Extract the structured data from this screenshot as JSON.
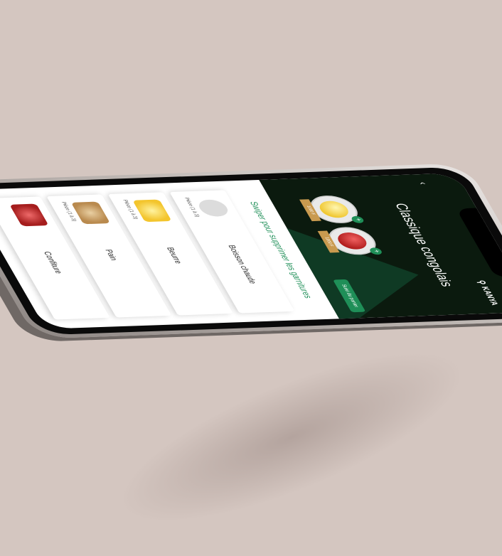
{
  "header": {
    "title": "Classique congolais",
    "brand": "KANYA",
    "back_icon": "back-arrow-icon",
    "pickup_badge": "Suivi du panier"
  },
  "dishes": [
    {
      "name": "Beurre",
      "price": "1000 F"
    },
    {
      "name": "Jambon",
      "price": "1000 F"
    }
  ],
  "hint": "Swiper pour supprimer les garnitures",
  "items": [
    {
      "name": "Boisson chaude",
      "meta": "Pièce (1 à 3)"
    },
    {
      "name": "Beurre",
      "meta": "Pièce (1 à 3)"
    },
    {
      "name": "Pain",
      "meta": "Pièce (1 à 3)"
    },
    {
      "name": "Confiture",
      "meta": ""
    }
  ]
}
